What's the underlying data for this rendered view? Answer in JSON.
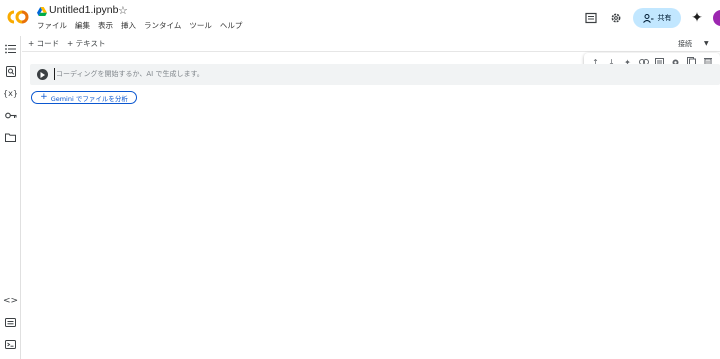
{
  "header": {
    "filename": "Untitled1.ipynb",
    "menu": [
      "ファイル",
      "編集",
      "表示",
      "挿入",
      "ランタイム",
      "ツール",
      "ヘルプ"
    ],
    "share_label": "共有",
    "icons": [
      "comments-icon",
      "settings-icon",
      "gemini-sparkle-icon",
      "avatar"
    ]
  },
  "toolbar": {
    "add_code": "+ コード",
    "add_text": "+ テキスト",
    "connect_label": "接続"
  },
  "cell": {
    "placeholder": "コーディングを開始するか、AI で生成します。"
  },
  "gemini": {
    "button_label": "Gemini でファイルを分析"
  },
  "colors": {
    "share_bg": "#c2e7ff",
    "gemini_accent": "#0b57d0",
    "cell_bg": "#f1f3f4",
    "logo_orange": "#f9ab00",
    "logo_dark_orange": "#e8710a"
  }
}
